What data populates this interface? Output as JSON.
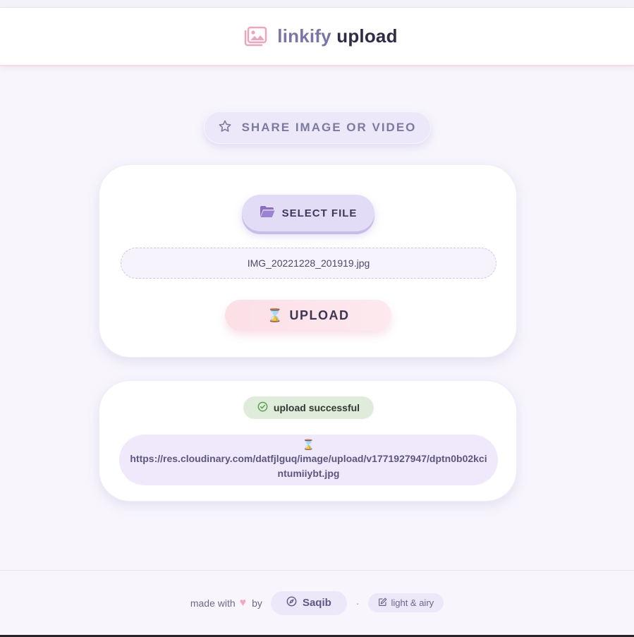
{
  "header": {
    "brand_primary": "linkify",
    "brand_secondary": "upload",
    "logo_icon": "images-icon"
  },
  "hero": {
    "label": "SHARE IMAGE OR VIDEO",
    "icon": "star-icon"
  },
  "upload_card": {
    "select_label": "SELECT FILE",
    "select_icon": "folder-open-icon",
    "file_name": "IMG_20221228_201919.jpg",
    "upload_glyph": "⌛",
    "upload_label": "UPLOAD"
  },
  "result_card": {
    "status_text": "upload successful",
    "status_icon": "check-circle-icon",
    "link_glyph": "⌛",
    "link_url": "https://res.cloudinary.com/datfjlguq/image/upload/v1771927947/dptn0b02kcintumiiybt.jpg"
  },
  "footer": {
    "made_with": "made with",
    "by": "by",
    "author": "Saqib",
    "separator": "·",
    "theme_label": "light & airy"
  },
  "colors": {
    "accent": "#7a74aa",
    "pink": "#f4a7bc",
    "success_bg": "#dfecdc",
    "success_icon": "#5aa04a"
  }
}
